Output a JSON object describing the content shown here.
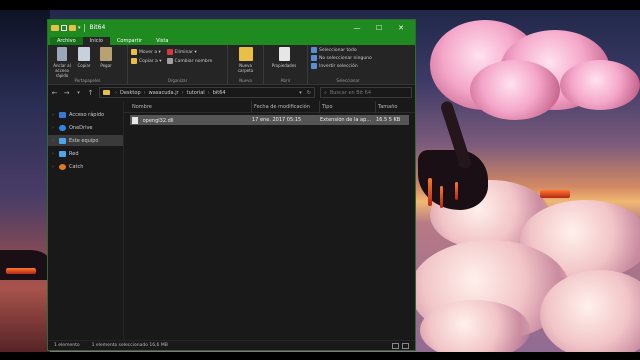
{
  "window": {
    "title": "Bit64",
    "controls": {
      "minimize": "—",
      "maximize": "☐",
      "close": "✕"
    }
  },
  "tabs": [
    {
      "label": "Archivo"
    },
    {
      "label": "Inicio"
    },
    {
      "label": "Compartir"
    },
    {
      "label": "Vista"
    }
  ],
  "ribbon": {
    "groups": [
      {
        "label": "Portapapeles",
        "buttons": [
          "Anclar al acceso rápido",
          "Copiar",
          "Pegar"
        ]
      },
      {
        "label": "Organizar",
        "buttons": [
          "Mover a ▾",
          "Copiar a ▾",
          "Eliminar ▾",
          "Cambiar nombre"
        ]
      },
      {
        "label": "Nuevo",
        "buttons": [
          "Nueva carpeta"
        ]
      },
      {
        "label": "Abrir",
        "buttons": [
          "Propiedades"
        ]
      },
      {
        "label": "Seleccionar",
        "buttons": [
          "Seleccionar todo",
          "No seleccionar ninguno",
          "Invertir selección"
        ]
      }
    ]
  },
  "address": {
    "crumbs": [
      "Desktop",
      "wasacuda.jr",
      "tutorial",
      "bit64"
    ],
    "search_placeholder": "Buscar en Bit 64"
  },
  "navpane": {
    "items": [
      {
        "label": "Acceso rápido",
        "icon": "star-icon",
        "color": "#3b78d6"
      },
      {
        "label": "OneDrive",
        "icon": "cloud-icon",
        "color": "#2f86e0"
      },
      {
        "label": "Este equipo",
        "icon": "computer-icon",
        "color": "#4fa3e8",
        "selected": true
      },
      {
        "label": "Red",
        "icon": "network-icon",
        "color": "#4fa3e8"
      },
      {
        "label": "Catch",
        "icon": "catch-icon",
        "color": "#e07a1a"
      }
    ]
  },
  "columns": [
    "Nombre",
    "Fecha de modificación",
    "Tipo",
    "Tamaño"
  ],
  "files": [
    {
      "name": "opengl32.dll",
      "date": "17 ene. 2017 05:15",
      "type": "Extensión de la ap...",
      "size": "16.5 5 KB",
      "selected": true
    }
  ],
  "statusbar": {
    "count": "1 elemento",
    "selection": "1 elemento seleccionado 16,6 MB"
  }
}
